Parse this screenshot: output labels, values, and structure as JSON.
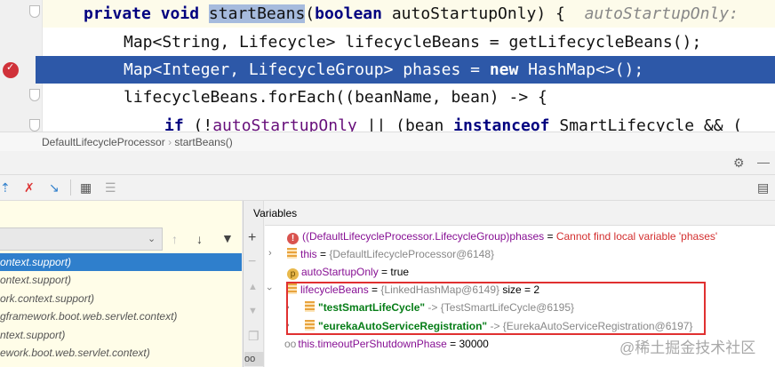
{
  "editor": {
    "line1": {
      "kw1": "private",
      "kw2": "void",
      "method": "startBeans",
      "paren": "(",
      "kw3": "boolean",
      "rest": " autoStartupOnly) {",
      "hint": "autoStartupOnly:"
    },
    "line2": "Map<String, Lifecycle> lifecycleBeans = getLifecycleBeans();",
    "line3": {
      "pre": "Map<Integer, LifecycleGroup> phases = ",
      "kw": "new",
      "post": " HashMap<>();"
    },
    "line4": "lifecycleBeans.forEach((beanName, bean) -> {",
    "line5": {
      "kw": "if",
      "a": " (!",
      "field": "autoStartupOnly",
      "b": " || (bean ",
      "kw2": "instanceof",
      "c": " SmartLifecycle && ("
    }
  },
  "breadcrumb": [
    "DefaultLifecycleProcessor",
    "startBeans()"
  ],
  "frames_panel": {
    "frames": [
      "ontext.support)",
      "ontext.support)",
      "ork.context.support)",
      "gframework.boot.web.servlet.context)",
      "ntext.support)",
      "ework.boot.web.servlet.context)"
    ]
  },
  "variables_panel": {
    "title": "Variables",
    "rows": [
      {
        "name": "((DefaultLifecycleProcessor.LifecycleGroup)phases",
        "eq": " = ",
        "value": "Cannot find local variable 'phases'"
      },
      {
        "name": "this",
        "eq": " = ",
        "value": "{DefaultLifecycleProcessor@6148}"
      },
      {
        "name": "autoStartupOnly",
        "eq": " = ",
        "value": "true",
        "icon_letter": "p"
      },
      {
        "name": "lifecycleBeans",
        "eq": " = ",
        "value": "{LinkedHashMap@6149}",
        "extra": "  size = 2"
      },
      {
        "name": "\"testSmartLifeCycle\"",
        "eq": " -> ",
        "value": "{TestSmartLifeCycle@6195}"
      },
      {
        "name": "\"eurekaAutoServiceRegistration\"",
        "eq": " -> ",
        "value": "{EurekaAutoServiceRegistration@6197}"
      },
      {
        "name": "this.timeoutPerShutdownPhase",
        "eq": " = ",
        "value": "30000",
        "icon": "oo"
      }
    ]
  },
  "watermark": "@稀土掘金技术社区",
  "colors": {
    "exec_line": "#2d58a8",
    "selected_frame": "#2f7fcc",
    "highlight_box": "#e03030"
  }
}
